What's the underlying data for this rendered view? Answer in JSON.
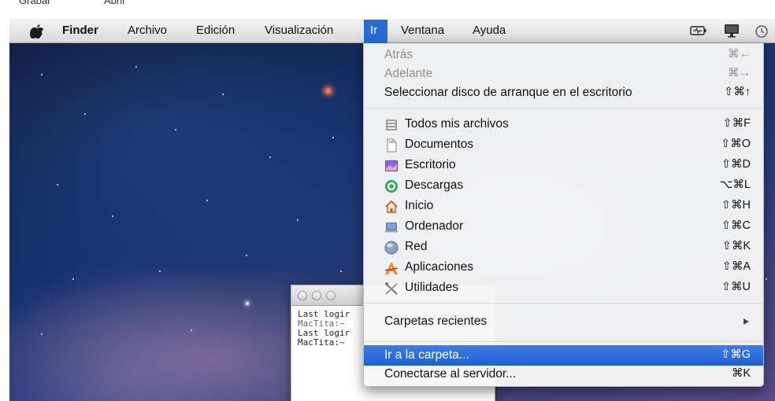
{
  "top_strip": {
    "left_text": "Grabar",
    "right_text": "Abrir"
  },
  "menubar": {
    "apple_icon": "apple-logo-icon",
    "items": [
      "Finder",
      "Archivo",
      "Edición",
      "Visualización",
      "Ir",
      "Ventana",
      "Ayuda"
    ],
    "active_item": "Ir",
    "status_icons": [
      "battery-icon",
      "display-icon",
      "time-machine-icon"
    ]
  },
  "terminal": {
    "lines": [
      "Last logir",
      "MacTita:~",
      "Last logir",
      "MacTita:~"
    ]
  },
  "go_menu": {
    "items": {
      "back": {
        "label": "Atrás",
        "shortcut": "⌘←"
      },
      "forward": {
        "label": "Adelante",
        "shortcut": "⌘→"
      },
      "startup": {
        "label": "Seleccionar disco de arranque en el escritorio",
        "shortcut": "⇧⌘↑"
      },
      "all_files": {
        "label": "Todos mis archivos",
        "shortcut": "⇧⌘F",
        "icon": "all-files-icon"
      },
      "documents": {
        "label": "Documentos",
        "shortcut": "⇧⌘O",
        "icon": "documents-icon"
      },
      "desktop": {
        "label": "Escritorio",
        "shortcut": "⇧⌘D",
        "icon": "desktop-icon"
      },
      "downloads": {
        "label": "Descargas",
        "shortcut": "⌥⌘L",
        "icon": "downloads-icon"
      },
      "home": {
        "label": "Inicio",
        "shortcut": "⇧⌘H",
        "icon": "home-icon"
      },
      "computer": {
        "label": "Ordenador",
        "shortcut": "⇧⌘C",
        "icon": "computer-icon"
      },
      "network": {
        "label": "Red",
        "shortcut": "⇧⌘K",
        "icon": "network-icon"
      },
      "applications": {
        "label": "Aplicaciones",
        "shortcut": "⇧⌘A",
        "icon": "applications-icon"
      },
      "utilities": {
        "label": "Utilidades",
        "shortcut": "⇧⌘U",
        "icon": "utilities-icon"
      },
      "recent": {
        "label": "Carpetas recientes"
      },
      "goto_folder": {
        "label": "Ir a la carpeta...",
        "shortcut": "⇧⌘G"
      },
      "connect": {
        "label": "Conectarse al servidor...",
        "shortcut": "⌘K"
      }
    },
    "highlighted_item": "Ir a la carpeta...",
    "highlight_color": "#2a6ad8"
  }
}
